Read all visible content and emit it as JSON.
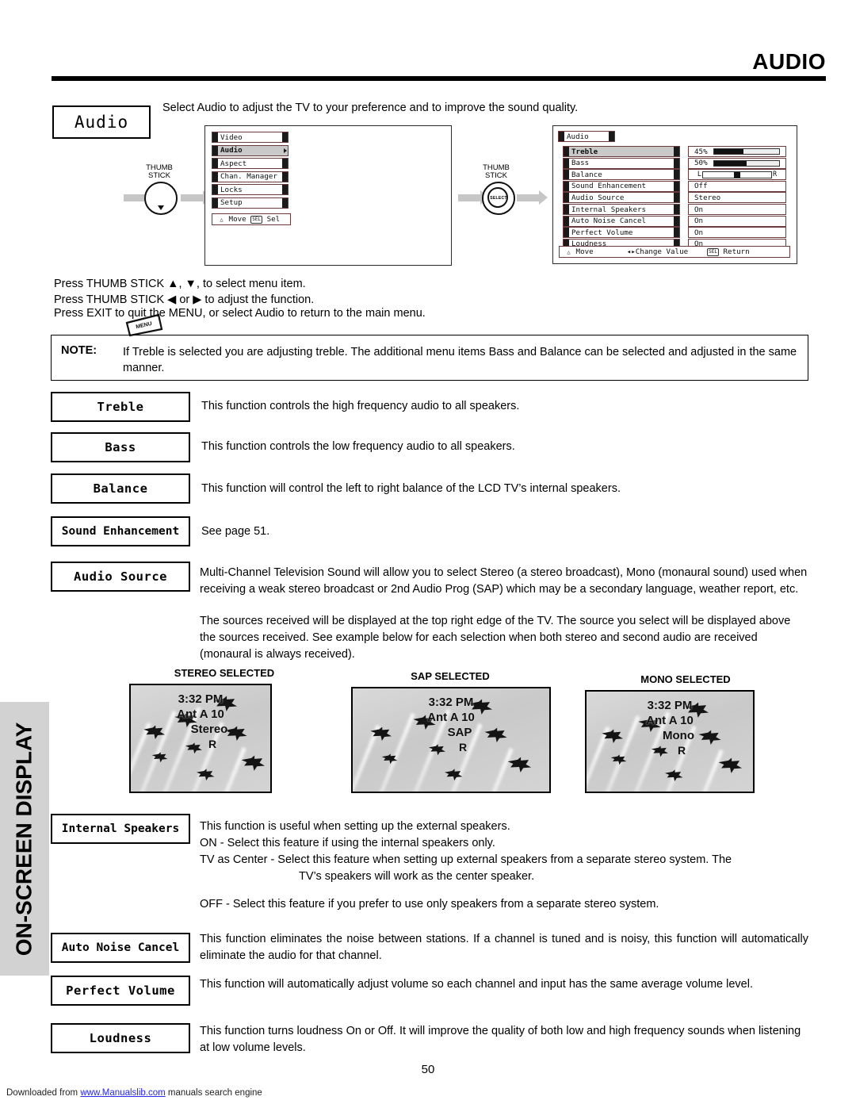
{
  "header": {
    "title": "AUDIO"
  },
  "side_tab": {
    "label": "ON-SCREEN DISPLAY"
  },
  "intro": {
    "chip_label": "Audio",
    "text": "Select Audio to adjust the TV to your preference and to improve the sound quality."
  },
  "diagram": {
    "menu_button_label": "MENU",
    "thumb_stick_label_line1": "THUMB",
    "thumb_stick_label_line2": "STICK",
    "select_knob_label": "SELECT",
    "main_menu": {
      "items": [
        {
          "label": "Video",
          "selected": false
        },
        {
          "label": "Audio",
          "selected": true
        },
        {
          "label": "Aspect",
          "selected": false
        },
        {
          "label": "Chan. Manager",
          "selected": false
        },
        {
          "label": "Locks",
          "selected": false
        },
        {
          "label": "Setup",
          "selected": false
        }
      ],
      "hint_move": "Move",
      "hint_sel_key": "SEL",
      "hint_sel": "Sel"
    },
    "audio_menu": {
      "title": "Audio",
      "rows": [
        {
          "label": "Treble",
          "value": "45%",
          "selected": true,
          "type": "meter",
          "percent": 45
        },
        {
          "label": "Bass",
          "value": "50%",
          "selected": false,
          "type": "meter",
          "percent": 50
        },
        {
          "label": "Balance",
          "value": "",
          "selected": false,
          "type": "balance",
          "left": "L",
          "right": "R",
          "position": 50
        },
        {
          "label": "Sound Enhancement",
          "value": "Off",
          "selected": false,
          "type": "text"
        },
        {
          "label": "Audio Source",
          "value": "Stereo",
          "selected": false,
          "type": "text"
        },
        {
          "label": "Internal Speakers",
          "value": "On",
          "selected": false,
          "type": "text"
        },
        {
          "label": "Auto Noise Cancel",
          "value": "On",
          "selected": false,
          "type": "text"
        },
        {
          "label": "Perfect Volume",
          "value": "On",
          "selected": false,
          "type": "text"
        },
        {
          "label": "Loudness",
          "value": "On",
          "selected": false,
          "type": "text"
        }
      ],
      "hint_move": "Move",
      "hint_change": "Change Value",
      "hint_sel_key": "SEL",
      "hint_return": "Return"
    }
  },
  "press_lines": [
    "Press THUMB STICK ▲, ▼, to select menu item.",
    "Press THUMB STICK  ◀ or ▶ to adjust the function.",
    "Press EXIT to quit the MENU, or select Audio to return to the main menu."
  ],
  "note": {
    "label": "NOTE:",
    "text": "If Treble is selected you are adjusting treble.  The additional menu items Bass and Balance can be selected and adjusted in the same manner."
  },
  "features": [
    {
      "name": "Treble",
      "desc": "This function controls the high frequency audio to all speakers."
    },
    {
      "name": "Bass",
      "desc": "This function controls the low frequency audio to all speakers."
    },
    {
      "name": "Balance",
      "desc": "This function will control the left to right balance of the LCD TV’s internal speakers."
    },
    {
      "name": "Sound Enhancement",
      "desc": "See page 51."
    },
    {
      "name": "Audio Source",
      "desc": "Multi-Channel Television Sound will allow you to select Stereo (a stereo broadcast), Mono (monaural sound) used when receiving a weak stereo broadcast or 2nd Audio Prog (SAP) which may be a secondary language, weather report, etc."
    },
    {
      "name": "Internal Speakers",
      "desc": ""
    },
    {
      "name": "Auto Noise Cancel",
      "desc": "This function eliminates the noise between stations. If a channel is tuned and is noisy, this function will automatically eliminate the audio for that channel."
    },
    {
      "name": "Perfect Volume",
      "desc": "This function will automatically adjust volume so each channel  and input has the same average volume level."
    },
    {
      "name": "Loudness",
      "desc": "This function turns loudness On or Off.  It will improve the quality of both low and high frequency sounds when listening at low volume levels."
    }
  ],
  "audio_source_extra": "The sources received will be displayed at the top right edge of the TV.  The source you select will be displayed above the sources received.  See example below for each selection when both stereo and second audio are received (monaural is always received).",
  "internal_speakers_desc": {
    "line1": "This function is useful when setting up the external speakers.",
    "line2": "ON - Select this feature if using the internal speakers only.",
    "line3": "TV as Center - Select this feature when setting up external speakers from a separate stereo system.  The",
    "line4": "TV’s speakers will work as the center speaker.",
    "line5": "OFF - Select this feature if you prefer to use only speakers from a separate stereo system."
  },
  "tv_examples": [
    {
      "caption": "STEREO SELECTED",
      "time": "3:32 PM",
      "channel": "Ant A 10",
      "source": "Stereo",
      "flag": "R"
    },
    {
      "caption": "SAP SELECTED",
      "time": "3:32 PM",
      "channel": "Ant A 10",
      "source": "SAP",
      "flag": "R"
    },
    {
      "caption": "MONO SELECTED",
      "time": "3:32 PM",
      "channel": "Ant A 10",
      "source": "Mono",
      "flag": "R"
    }
  ],
  "footer": {
    "page_number": "50",
    "downloaded_prefix": "Downloaded from ",
    "link": "www.Manualslib.com",
    "downloaded_suffix": " manuals search engine"
  },
  "colors": {
    "tab_bg": "#d2d2d2",
    "osd_selected": "#c9c9c9",
    "link": "#2a2af0"
  }
}
